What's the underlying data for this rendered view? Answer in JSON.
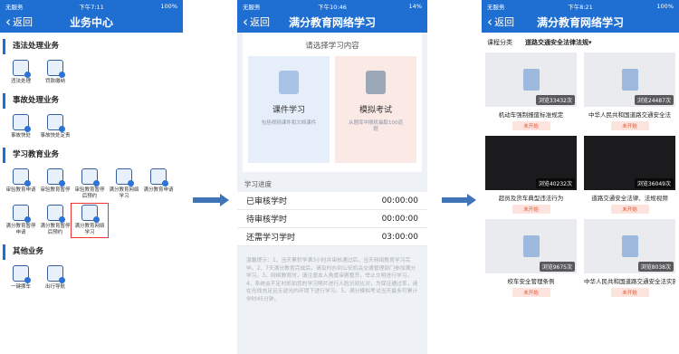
{
  "phone1": {
    "status_left": "无服务",
    "status_time": "下午7:11",
    "status_right": "100%",
    "back": "返回",
    "title": "业务中心",
    "sections": [
      {
        "title": "违法处理业务",
        "items": [
          "违法处理",
          "罚款缴纳"
        ]
      },
      {
        "title": "事故处理业务",
        "items": [
          "事故快处",
          "事故快处定责"
        ]
      },
      {
        "title": "学习教育业务",
        "items": [
          "审验教育申请",
          "审验教育暂停",
          "审验教育暂停后预约",
          "满分教育网络学习",
          "满分教育申请",
          "满分教育暂停申请",
          "满分教育暂停后预约",
          "满分教育网络学习"
        ]
      },
      {
        "title": "其他业务",
        "items": [
          "一键挪车",
          "出行导航"
        ]
      }
    ]
  },
  "phone2": {
    "status_left": "无服务",
    "status_time": "下午10:46",
    "status_right": "14%",
    "back": "返回",
    "title": "满分教育网络学习",
    "prompt": "请选择学习内容",
    "option1": {
      "title": "课件学习",
      "desc": "包括视频课件和文档课件"
    },
    "option2": {
      "title": "模拟考试",
      "desc": "从题库中随机抽取100道题"
    },
    "progress_heading": "学习进度",
    "progress": [
      {
        "label": "已审核学时",
        "value": "00:00:00"
      },
      {
        "label": "待审核学时",
        "value": "00:00:00"
      },
      {
        "label": "还需学习学时",
        "value": "03:00:00"
      }
    ],
    "notes": "温馨提示：1、当天累积学满3小时并审核通过后，当天网络教育学习完毕。2、7天满分教育完成后，请及时办到公安机关交通管理部门参加满分学习。3、网络教育时，请注意本人角度审察整齐，举止文明进行学习。4、系统会不定时抓拍您的学习照片进行人脸识别比对，为保证通过率，请在光线充足且无逆光的环境下进行学习。5、满分模拟考试当天最多可累计学时45分钟。"
  },
  "phone3": {
    "status_left": "无服务",
    "status_time": "下午8:21",
    "status_right": "100%",
    "back": "返回",
    "title": "满分教育网络学习",
    "filter_label": "课程分类",
    "filter_value": "道路交通安全法律法规",
    "courses": [
      {
        "views": "浏览33432次",
        "name": "机动车强制报废标准规定",
        "status": "未开始",
        "dark": false
      },
      {
        "views": "浏览24487次",
        "name": "中华人民共和国道路交通安全法",
        "status": "未开始",
        "dark": false
      },
      {
        "views": "浏览40232次",
        "name": "超员及货车典型违法行为",
        "status": "未开始",
        "dark": true
      },
      {
        "views": "浏览36049次",
        "name": "道路交通安全法律、法规视频",
        "status": "未开始",
        "dark": true
      },
      {
        "views": "浏览9675次",
        "name": "校车安全管理条例",
        "status": "未开始",
        "dark": false
      },
      {
        "views": "浏览8038次",
        "name": "中华人民共和国道路交通安全法实施条例",
        "status": "未开始",
        "dark": false
      }
    ]
  }
}
